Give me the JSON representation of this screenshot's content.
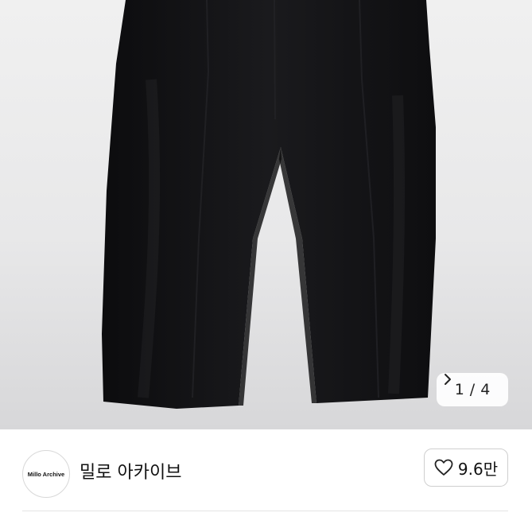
{
  "product_gallery": {
    "current_image": "1",
    "separator": "/",
    "total_images": "4",
    "next_icon": "chevron-right-icon",
    "subject": "black wide pants"
  },
  "shop": {
    "avatar_text": "Millo Archive",
    "name": "밀로 아카이브",
    "like_icon": "heart-outline-icon",
    "like_count": "9.6만"
  },
  "colors": {
    "pants": "#141416",
    "background_top": "#f0f0f0",
    "background_bottom": "#d7d7d9",
    "text": "#111111",
    "border": "#cfcfcf"
  }
}
